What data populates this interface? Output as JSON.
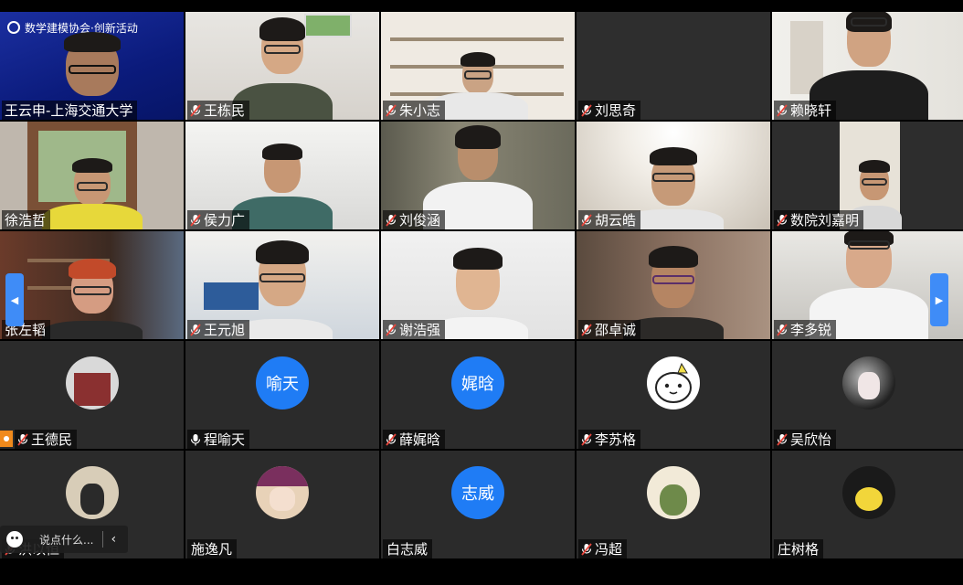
{
  "window": {
    "title": ""
  },
  "banner": {
    "text": "数学建模协会·创新活动"
  },
  "participants": [
    {
      "name": "王云申-上海交通大学",
      "type": "video"
    },
    {
      "name": "王栋民",
      "type": "video"
    },
    {
      "name": "朱小志",
      "type": "video"
    },
    {
      "name": "刘思奇",
      "type": "video"
    },
    {
      "name": "赖晓轩",
      "type": "video"
    },
    {
      "name": "徐浩哲",
      "type": "video"
    },
    {
      "name": "侯力广",
      "type": "video"
    },
    {
      "name": "刘俊涵",
      "type": "video"
    },
    {
      "name": "胡云皓",
      "type": "video"
    },
    {
      "name": "数院刘嘉明",
      "type": "video"
    },
    {
      "name": "张左韬",
      "type": "video"
    },
    {
      "name": "王元旭",
      "type": "video"
    },
    {
      "name": "谢浩强",
      "type": "video"
    },
    {
      "name": "邵卓诚",
      "type": "video"
    },
    {
      "name": "李多锐",
      "type": "video"
    },
    {
      "name": "王德民",
      "type": "avatar"
    },
    {
      "name": "程喻天",
      "type": "avatar",
      "avatar_text": "喻天"
    },
    {
      "name": "薛娓晗",
      "type": "avatar",
      "avatar_text": "娓晗"
    },
    {
      "name": "李苏格",
      "type": "avatar"
    },
    {
      "name": "吴欣怡",
      "type": "avatar"
    },
    {
      "name": "洪以恒",
      "type": "avatar"
    },
    {
      "name": "施逸凡",
      "type": "avatar"
    },
    {
      "name": "白志威",
      "type": "avatar",
      "avatar_text": "志威"
    },
    {
      "name": "冯超",
      "type": "avatar"
    },
    {
      "name": "庄树格",
      "type": "avatar"
    }
  ],
  "chat": {
    "placeholder": "说点什么..."
  },
  "icons": {
    "mic_muted": "mic-muted-icon",
    "mic_on": "mic-icon",
    "page_prev": "chevron-left-icon",
    "page_next": "chevron-right-icon",
    "emoji": "emoji-icon",
    "collapse": "chevron-left-icon"
  },
  "colors": {
    "avatar_blue": "#1f7cf5",
    "arrow_blue": "#3f8cf7",
    "mute_red": "#e8473d"
  }
}
